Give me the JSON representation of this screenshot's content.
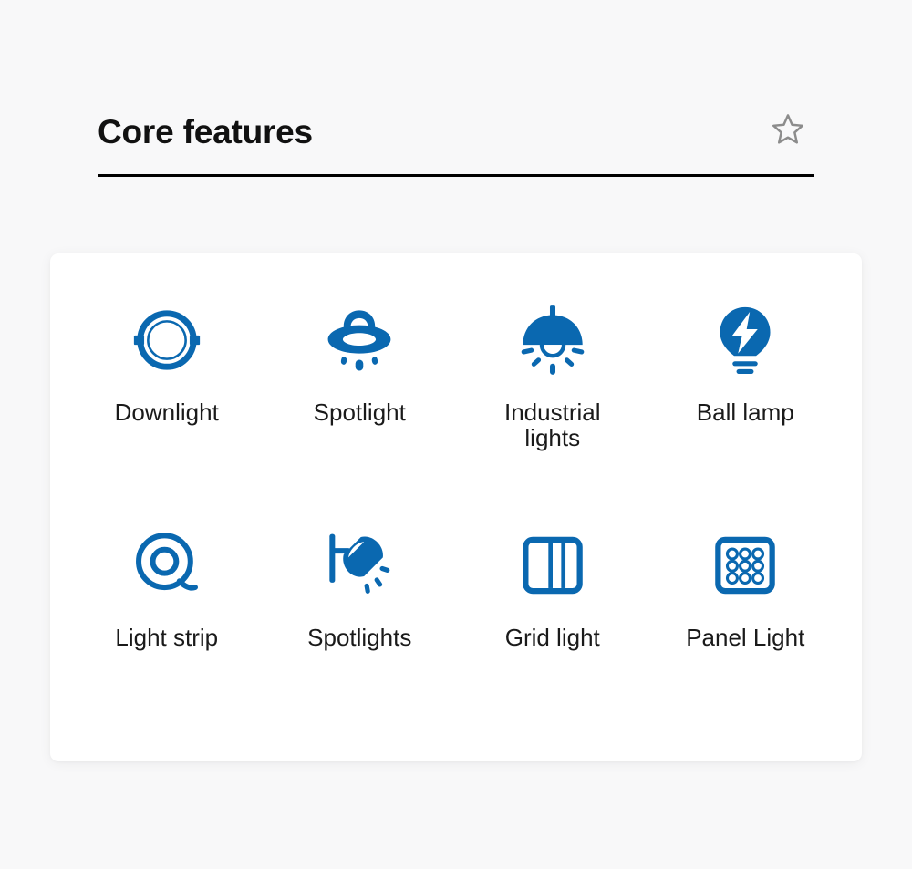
{
  "header": {
    "title": "Core features",
    "favorite_icon": "star-outline-icon",
    "favorite_active": false
  },
  "theme": {
    "page_background": "#f8f8f9",
    "card_background": "#ffffff",
    "accent_blue": "#0a68b0",
    "title_color": "#111111",
    "label_color": "#1a1a1a",
    "divider_color": "#000000",
    "star_color": "#8c8c8c"
  },
  "card": {
    "columns": 4,
    "rows": 2,
    "items": [
      {
        "label": "Downlight",
        "icon": "downlight-icon"
      },
      {
        "label": "Spotlight",
        "icon": "spotlight-saucer-icon"
      },
      {
        "label": "Industrial lights",
        "icon": "industrial-pendant-lamp-icon"
      },
      {
        "label": "Ball lamp",
        "icon": "ball-lamp-bolt-icon"
      },
      {
        "label": "Light strip",
        "icon": "light-strip-coil-icon"
      },
      {
        "label": "Spotlights",
        "icon": "wall-spotlight-icon"
      },
      {
        "label": "Grid light",
        "icon": "grid-light-icon"
      },
      {
        "label": "Panel Light",
        "icon": "panel-light-icon"
      }
    ]
  }
}
